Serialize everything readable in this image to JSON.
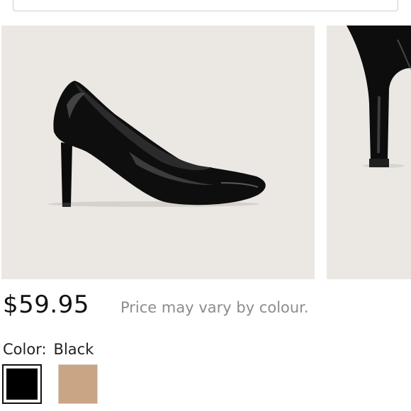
{
  "product": {
    "price": "$59.95",
    "price_note": "Price may vary by colour.",
    "color_label": "Color:",
    "selected_color": "Black",
    "colors": [
      {
        "name": "black-swatch",
        "hex": "#000000",
        "selected": true
      },
      {
        "name": "nude-swatch",
        "hex": "#c9a585",
        "selected": false
      }
    ]
  },
  "theme": {
    "photo_bg": "#ebe8e4",
    "price_note_color": "#8c8c8c"
  },
  "icons": {
    "search": "search-icon"
  }
}
